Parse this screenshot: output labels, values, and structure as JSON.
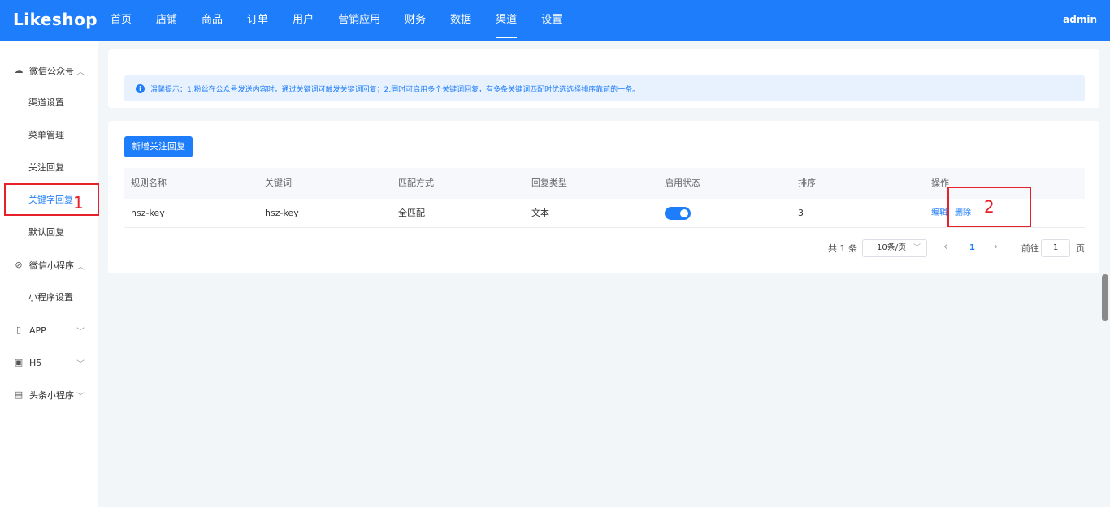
{
  "header": {
    "logo": "Likeshop",
    "nav": [
      "首页",
      "店铺",
      "商品",
      "订单",
      "用户",
      "营销应用",
      "财务",
      "数据",
      "渠道",
      "设置"
    ],
    "active_nav": "渠道",
    "user": "admin"
  },
  "sidebar": {
    "groups": [
      {
        "label": "微信公众号",
        "icon": "wechat-icon",
        "chevron": "up",
        "items": [
          "渠道设置",
          "菜单管理",
          "关注回复",
          "关键字回复",
          "默认回复"
        ]
      },
      {
        "label": "微信小程序",
        "icon": "mini-program-icon",
        "chevron": "up",
        "items": [
          "小程序设置"
        ]
      },
      {
        "label": "APP",
        "icon": "phone-icon",
        "chevron": "down",
        "items": []
      },
      {
        "label": "H5",
        "icon": "h5-icon",
        "chevron": "down",
        "items": []
      },
      {
        "label": "头条小程序",
        "icon": "toutiao-icon",
        "chevron": "down",
        "items": []
      }
    ],
    "active_item": "关键字回复"
  },
  "tip": {
    "text": "温馨提示：1.粉丝在公众号发送内容时，通过关键词可触发关键词回复；2.同时可启用多个关键词回复，有多条关键词匹配时优选选择排序靠前的一条。"
  },
  "toolbar": {
    "add_label": "新增关注回复"
  },
  "table": {
    "columns": [
      "规则名称",
      "关键词",
      "匹配方式",
      "回复类型",
      "启用状态",
      "排序",
      "操作"
    ],
    "rows": [
      {
        "name": "hsz-key",
        "keyword": "hsz-key",
        "match": "全匹配",
        "reply_type": "文本",
        "enabled": true,
        "sort": "3",
        "actions": [
          "编辑",
          "删除"
        ]
      }
    ]
  },
  "pagination": {
    "total": "共 1 条",
    "page_size": "10条/页",
    "prev": "‹",
    "current": "1",
    "next": "›",
    "goto_label": "前往",
    "goto_value": "1",
    "page_suffix": "页"
  },
  "annotations": {
    "box1_label": "1",
    "box2_label": "2"
  },
  "colors": {
    "primary": "#1e7dfa",
    "annotation": "#e8202a",
    "background": "#f3f6f9"
  }
}
